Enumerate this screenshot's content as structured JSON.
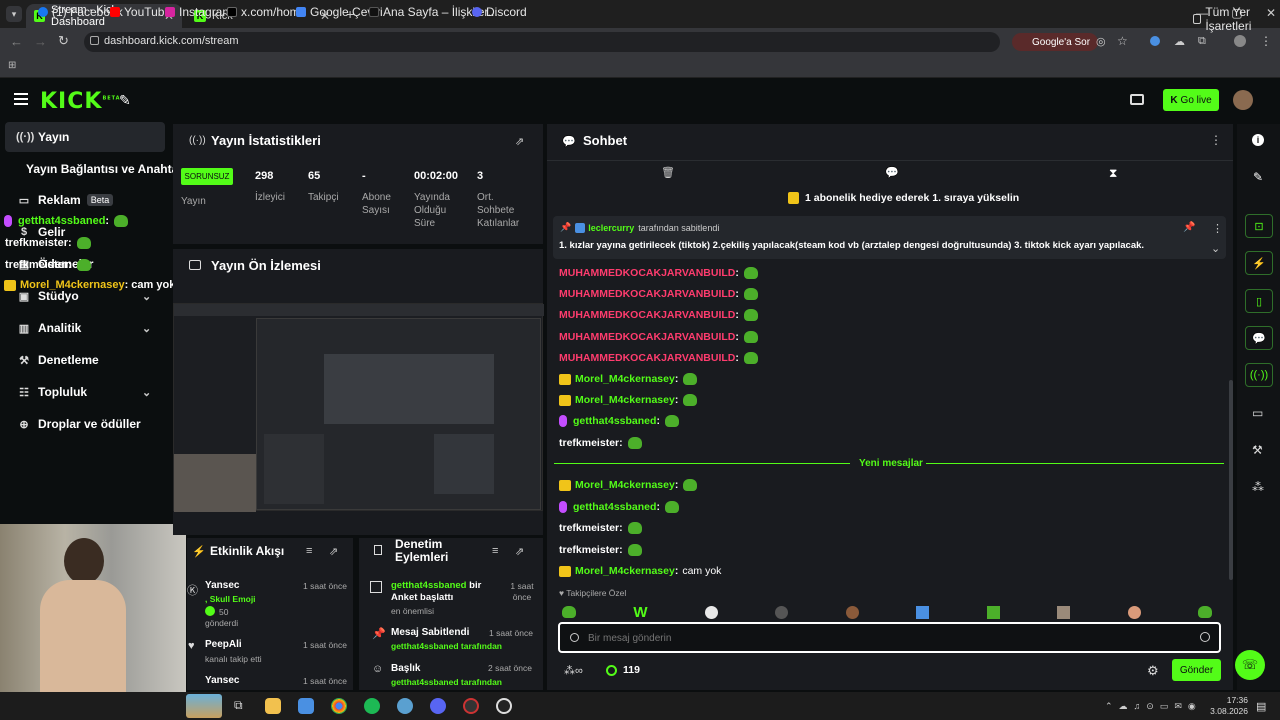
{
  "browser": {
    "tabs": [
      {
        "label": "Stream - Kick Dashboard",
        "active": true
      },
      {
        "label": "Kick",
        "active": false
      }
    ],
    "url": "dashboard.kick.com/stream",
    "google_btn": "Google'a Sor",
    "bookmarks": [
      "(1) Facebook",
      "YouTube",
      "Instagram",
      "x.com/home",
      "Google Çeviri",
      "Ana Sayfa – İlişkiler...",
      "Discord"
    ],
    "all_bookmarks": "Tüm Yer İşaretleri"
  },
  "header": {
    "logo": "KICK",
    "logo_sup": "BETA",
    "go_live": "Go live"
  },
  "sidebar": {
    "items": [
      {
        "label": "Yayın",
        "icon": "broadcast-icon"
      },
      {
        "label": "Yayın Bağlantısı ve Anahtarı"
      },
      {
        "label": "Reklam",
        "badge": "Beta",
        "icon": "ad-icon"
      },
      {
        "label": "Gelir",
        "icon": "revenue-icon"
      },
      {
        "label": "Ödemeler",
        "icon": "payment-icon"
      },
      {
        "label": "Stüdyo",
        "icon": "studio-icon"
      },
      {
        "label": "Analitik",
        "icon": "analytics-icon"
      },
      {
        "label": "Denetleme",
        "icon": "wrench-icon"
      },
      {
        "label": "Topluluk",
        "icon": "community-icon"
      },
      {
        "label": "Droplar ve ödüller",
        "icon": "gift-icon"
      }
    ],
    "overlay_chat": [
      {
        "name": "getthat4ssbaned",
        "text": ":"
      },
      {
        "name": "trefkmeister",
        "text": ":"
      },
      {
        "name": "trefkmeister",
        "text": ":"
      },
      {
        "name": "Morel_M4ckernasey",
        "text": ": cam yok"
      }
    ]
  },
  "stats": {
    "title": "Yayın İstatistikleri",
    "badge": "SORUNSUZ",
    "badge_label": "Yayın",
    "items": [
      {
        "value": "298",
        "label": "İzleyici"
      },
      {
        "value": "65",
        "label": "Takipçi"
      },
      {
        "value": "-",
        "label": "Abone Sayısı"
      },
      {
        "value": "00:02:00",
        "label": "Yayında Olduğu Süre"
      },
      {
        "value": "3",
        "label": "Ort. Sohbete Katılanlar"
      }
    ]
  },
  "preview": {
    "title": "Yayın Ön İzlemesi"
  },
  "activity": {
    "title": "Etkinlik Akışı",
    "items": [
      {
        "name": "Yansec",
        "time": "1 saat önce",
        "line2": ", Skull Emoji",
        "line3": "50",
        "line4": "gönderdi"
      },
      {
        "name": "PeepAli",
        "time": "1 saat önce",
        "line2": "kanalı takip etti"
      },
      {
        "name": "Yansec",
        "time": "1 saat önce"
      }
    ]
  },
  "moderation": {
    "title": "Denetim Eylemleri",
    "items": [
      {
        "user": "getthat4ssbaned",
        "action": "bir Anket başlattı",
        "sub": "en önemlisi",
        "time": "1 saat önce"
      },
      {
        "user": "Mesaj Sabitlendi",
        "action": "",
        "sub": "getthat4ssbaned tarafından",
        "time": "1 saat önce"
      },
      {
        "user": "Başlık",
        "action": "",
        "sub": "getthat4ssbaned tarafından",
        "time": "2 saat önce"
      }
    ]
  },
  "chat": {
    "title": "Sohbet",
    "gift_banner": "1 abonelik hediye ederek 1. sıraya yükselin",
    "pinned_by": "leclercurry",
    "pinned_by_suffix": "tarafından sabitlendi",
    "pinned_text": "1. kızlar yayına getirilecek (tiktok) 2.çekiliş yapılacak(steam kod vb (arztalep dengesi doğrultusunda) 3. tiktok kick ayarı yapılacak.",
    "messages": [
      {
        "user": "MUHAMMEDKOCAKJARVANBUILD",
        "color": "#ff3c6e",
        "badge": "none",
        "text": ""
      },
      {
        "user": "MUHAMMEDKOCAKJARVANBUILD",
        "color": "#ff3c6e",
        "badge": "none",
        "text": ""
      },
      {
        "user": "MUHAMMEDKOCAKJARVANBUILD",
        "color": "#ff3c6e",
        "badge": "none",
        "text": ""
      },
      {
        "user": "MUHAMMEDKOCAKJARVANBUILD",
        "color": "#ff3c6e",
        "badge": "none",
        "text": ""
      },
      {
        "user": "MUHAMMEDKOCAKJARVANBUILD",
        "color": "#ff3c6e",
        "badge": "none",
        "text": ""
      },
      {
        "user": "Morel_M4ckernasey",
        "color": "#53fc18",
        "badge": "crown",
        "text": ""
      },
      {
        "user": "Morel_M4ckernasey",
        "color": "#53fc18",
        "badge": "crown",
        "text": ""
      },
      {
        "user": "getthat4ssbaned",
        "color": "#53fc18",
        "badge": "mic",
        "text": ""
      },
      {
        "user": "trefkmeister",
        "color": "#ffffff",
        "badge": "none",
        "text": ""
      }
    ],
    "new_messages": "Yeni mesajlar",
    "messages_after": [
      {
        "user": "Morel_M4ckernasey",
        "color": "#53fc18",
        "badge": "crown",
        "text": ""
      },
      {
        "user": "getthat4ssbaned",
        "color": "#53fc18",
        "badge": "mic",
        "text": ""
      },
      {
        "user": "trefkmeister",
        "color": "#ffffff",
        "badge": "none",
        "text": ""
      },
      {
        "user": "trefkmeister",
        "color": "#ffffff",
        "badge": "none",
        "text": ""
      },
      {
        "user": "Morel_M4ckernasey",
        "color": "#53fc18",
        "badge": "crown",
        "text": "cam yok"
      }
    ],
    "follower_label": "Takipçilere Özel",
    "input_placeholder": "Bir mesaj gönderin",
    "points": "119",
    "send": "Gönder"
  },
  "taskbar": {
    "time": "17:36",
    "date": "3.08.2026"
  },
  "colors": {
    "accent": "#53fc18",
    "panel": "#191b1f",
    "bg": "#0b0e0f"
  }
}
